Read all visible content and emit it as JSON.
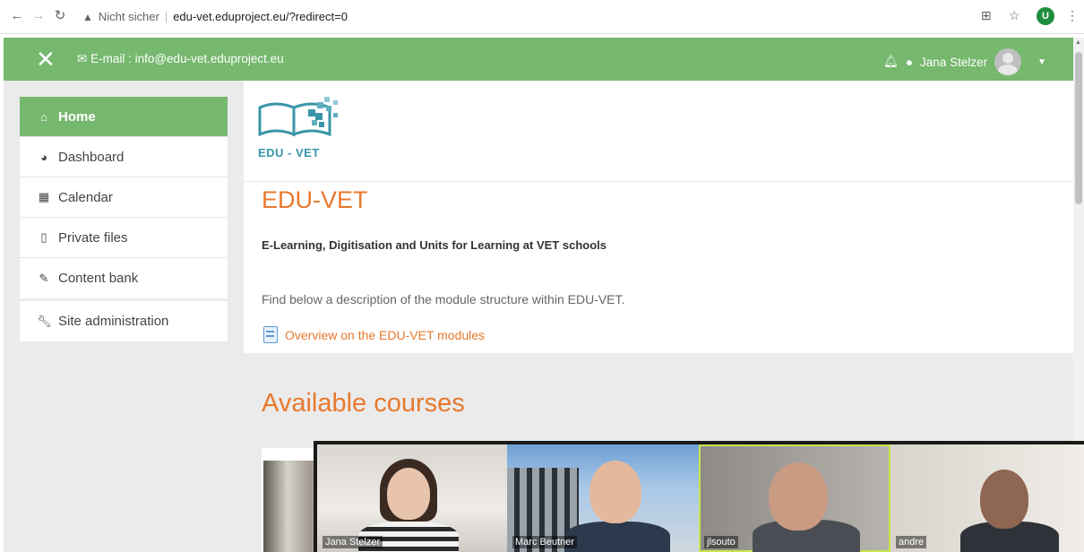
{
  "browser": {
    "insecure_label": "Nicht sicher",
    "url": "edu-vet.eduproject.eu/?redirect=0",
    "profile_initial": "U"
  },
  "header": {
    "email": "E-mail : info@edu-vet.eduproject.eu",
    "user_name": "Jana Stelzer"
  },
  "sidebar": {
    "items": [
      {
        "label": "Home"
      },
      {
        "label": "Dashboard"
      },
      {
        "label": "Calendar"
      },
      {
        "label": "Private files"
      },
      {
        "label": "Content bank"
      },
      {
        "label": "Site administration"
      }
    ]
  },
  "main": {
    "logo_text": "EDU - VET",
    "site_title": "EDU-VET",
    "subtitle": "E-Learning, Digitisation and Units for Learning at VET schools",
    "description": "Find below a description of the module structure within EDU-VET.",
    "link": "Overview on the EDU-VET modules",
    "courses_heading": "Available courses"
  },
  "video_call": {
    "participants": [
      {
        "name": "Jana Stelzer"
      },
      {
        "name": "Marc Beutner"
      },
      {
        "name": "jlsouto"
      },
      {
        "name": "andre"
      }
    ]
  },
  "colors": {
    "brand_green": "#76b86e",
    "accent_orange": "#e8792e",
    "active_speaker": "#c8e64c"
  }
}
